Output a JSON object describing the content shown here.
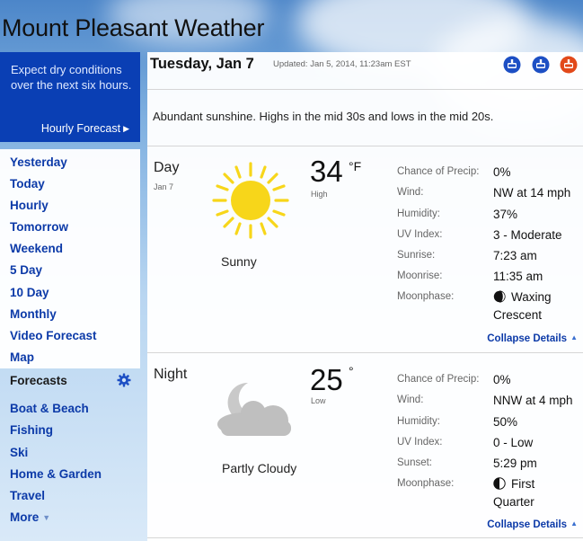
{
  "site": {
    "title": "Mount Pleasant Weather"
  },
  "promo": {
    "text": "Expect dry conditions over the next six hours.",
    "link": "Hourly Forecast",
    "link_arrow": "▶"
  },
  "nav": {
    "items": [
      "Yesterday",
      "Today",
      "Hourly",
      "Tomorrow",
      "Weekend",
      "5 Day",
      "10 Day",
      "Monthly",
      "Video Forecast",
      "Map"
    ],
    "forecasts_heading": "Forecasts",
    "forecast_items": [
      "Boat & Beach",
      "Fishing",
      "Ski",
      "Home & Garden",
      "Travel"
    ],
    "more_label": "More",
    "more_caret": "▼"
  },
  "header": {
    "date": "Tuesday, Jan 7",
    "updated": "Updated: Jan 5, 2014, 11:23am EST"
  },
  "summary": "Abundant sunshine. Highs in the mid 30s and lows in the mid 20s.",
  "day": {
    "period": "Day",
    "date": "Jan 7",
    "temp": "34",
    "unit": "°F",
    "temp_label": "High",
    "condition": "Sunny",
    "icon": "sun-icon",
    "details": [
      {
        "label": "Chance of Precip:",
        "value": "0%"
      },
      {
        "label": "Wind:",
        "value": "NW at 14 mph"
      },
      {
        "label": "Humidity:",
        "value": "37%"
      },
      {
        "label": "UV Index:",
        "value": "3 - Moderate"
      },
      {
        "label": "Sunrise:",
        "value": "7:23 am"
      },
      {
        "label": "Moonrise:",
        "value": "11:35 am"
      },
      {
        "label": "Moonphase:",
        "value": "Waxing",
        "value2": "Crescent"
      }
    ],
    "collapse": "Collapse Details",
    "collapse_arrow": "▲"
  },
  "night": {
    "period": "Night",
    "temp": "25",
    "unit": "°",
    "temp_label": "Low",
    "condition": "Partly Cloudy",
    "icon": "moon-cloud-icon",
    "details": [
      {
        "label": "Chance of Precip:",
        "value": "0%"
      },
      {
        "label": "Wind:",
        "value": "NNW at 4 mph"
      },
      {
        "label": "Humidity:",
        "value": "50%"
      },
      {
        "label": "UV Index:",
        "value": "0 - Low"
      },
      {
        "label": "Sunset:",
        "value": "5:29 pm"
      },
      {
        "label": "Moonphase:",
        "value": "First",
        "value2": "Quarter"
      }
    ],
    "collapse": "Collapse Details",
    "collapse_arrow": "▲"
  },
  "colors": {
    "nav_blue": "#0c3aa8",
    "promo_bg": "#0a3fb4",
    "sun_yellow": "#f7d61a",
    "share_icon_blue": "#1d4fc4",
    "share_icon_orange": "#e2491a"
  }
}
